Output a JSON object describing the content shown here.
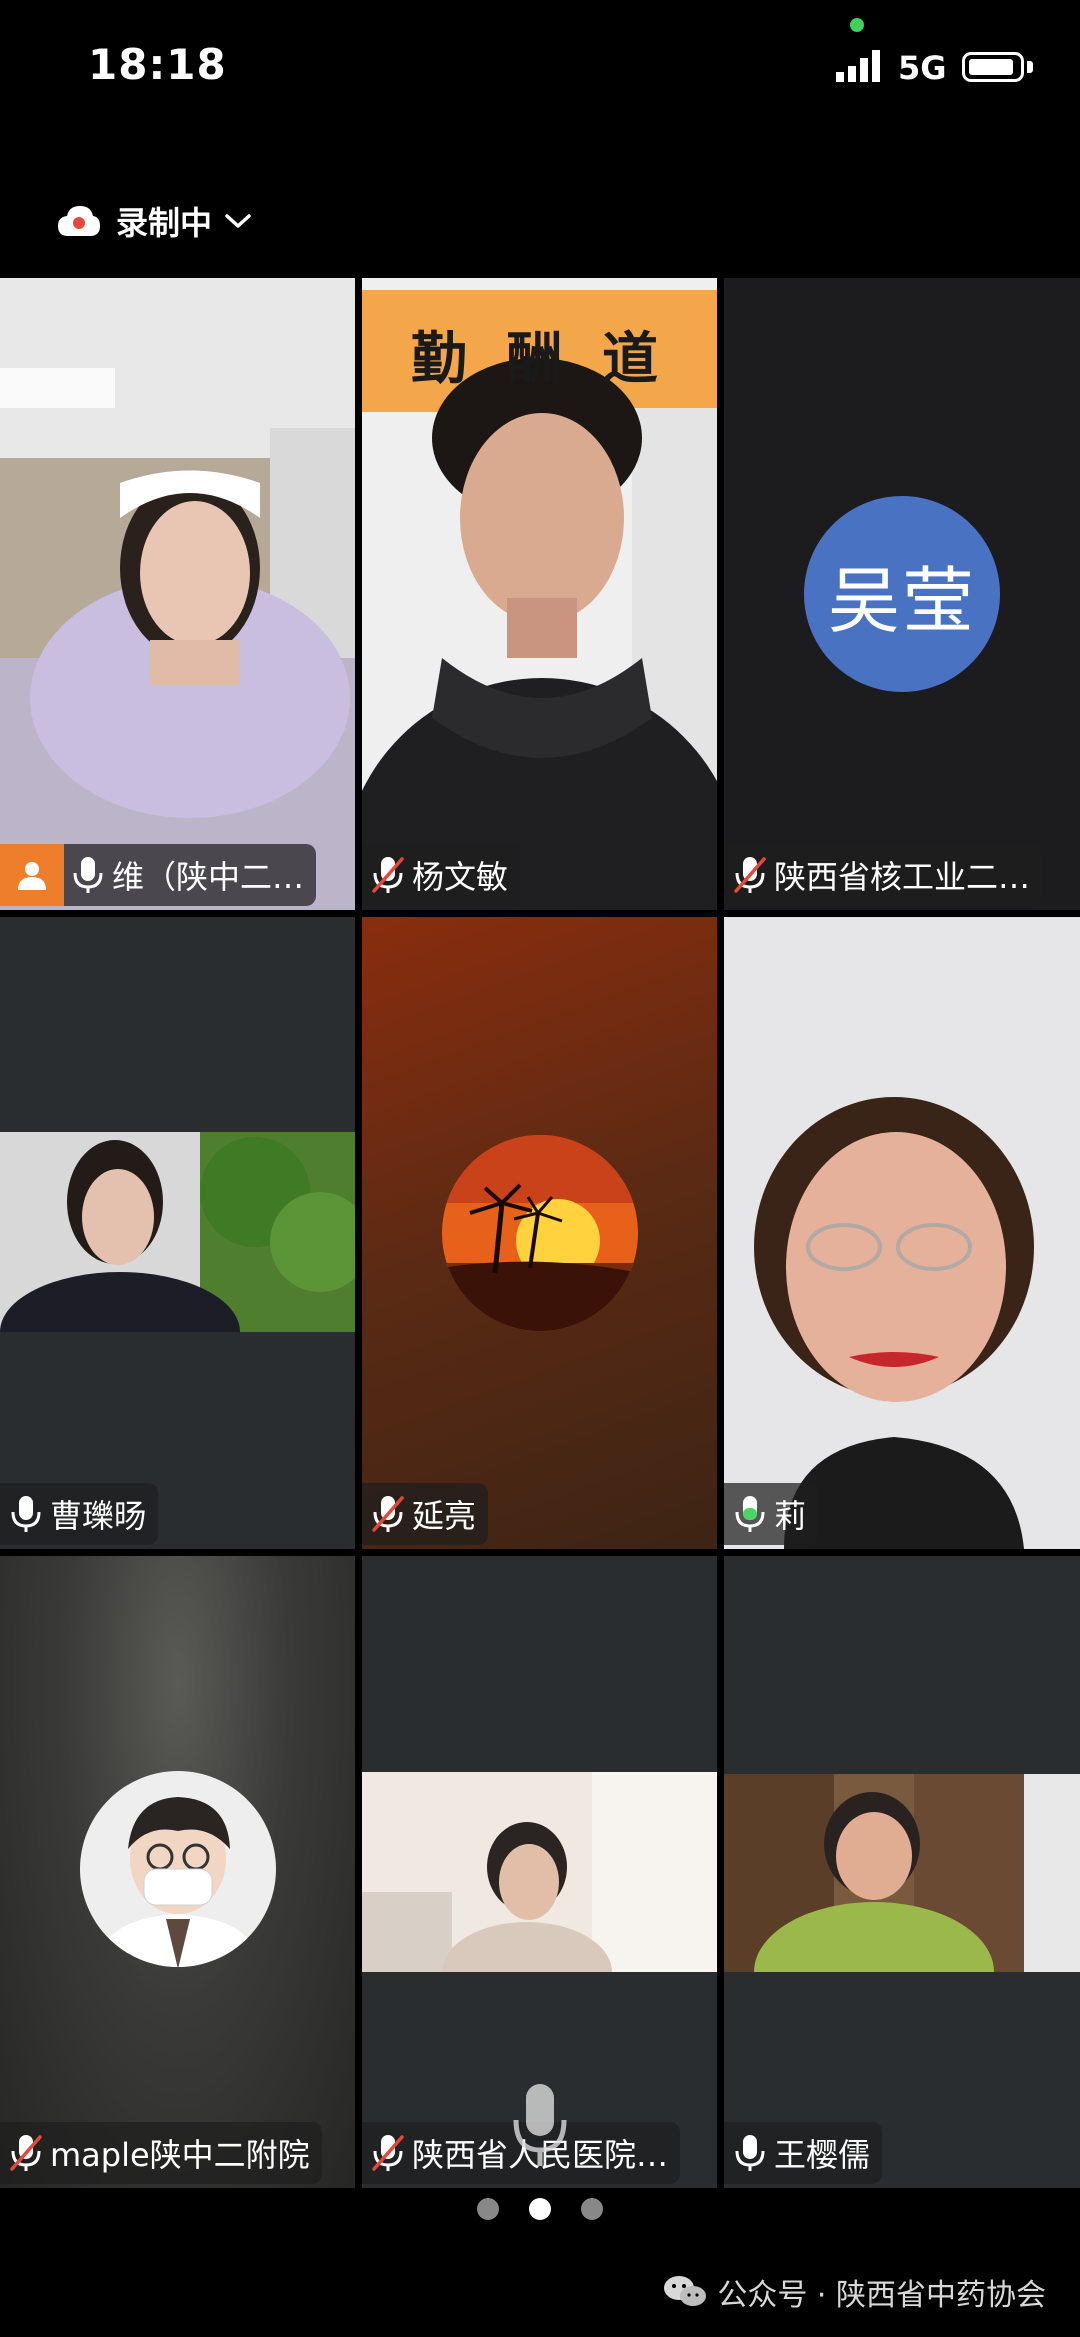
{
  "status_bar": {
    "time": "18:18",
    "network": "5G"
  },
  "recording": {
    "label": "录制中"
  },
  "participants": [
    {
      "name": "维（陕中二…",
      "mic": "on",
      "host": true
    },
    {
      "name": "杨文敏",
      "mic": "muted"
    },
    {
      "name": "陕西省核工业二…",
      "mic": "muted",
      "avatar_text": "吴莹"
    },
    {
      "name": "曹瓅旸",
      "mic": "on"
    },
    {
      "name": "延亮",
      "mic": "muted"
    },
    {
      "name": "莉",
      "mic": "speaking",
      "active": true
    },
    {
      "name": "maple陕中二附院",
      "mic": "muted"
    },
    {
      "name": "陕西省人民医院…",
      "mic": "muted"
    },
    {
      "name": "王樱儒",
      "mic": "on"
    }
  ],
  "backdrop_text": "勤  酬  道",
  "pager": {
    "pages": 3,
    "current": 2
  },
  "watermark": {
    "text": "公众号 · 陕西省中药协会"
  },
  "colors": {
    "active_border": "#4cd464",
    "host_badge": "#ee7d2c",
    "avatar_bg": "#4a72c3",
    "record_dot": "#e5483b"
  }
}
